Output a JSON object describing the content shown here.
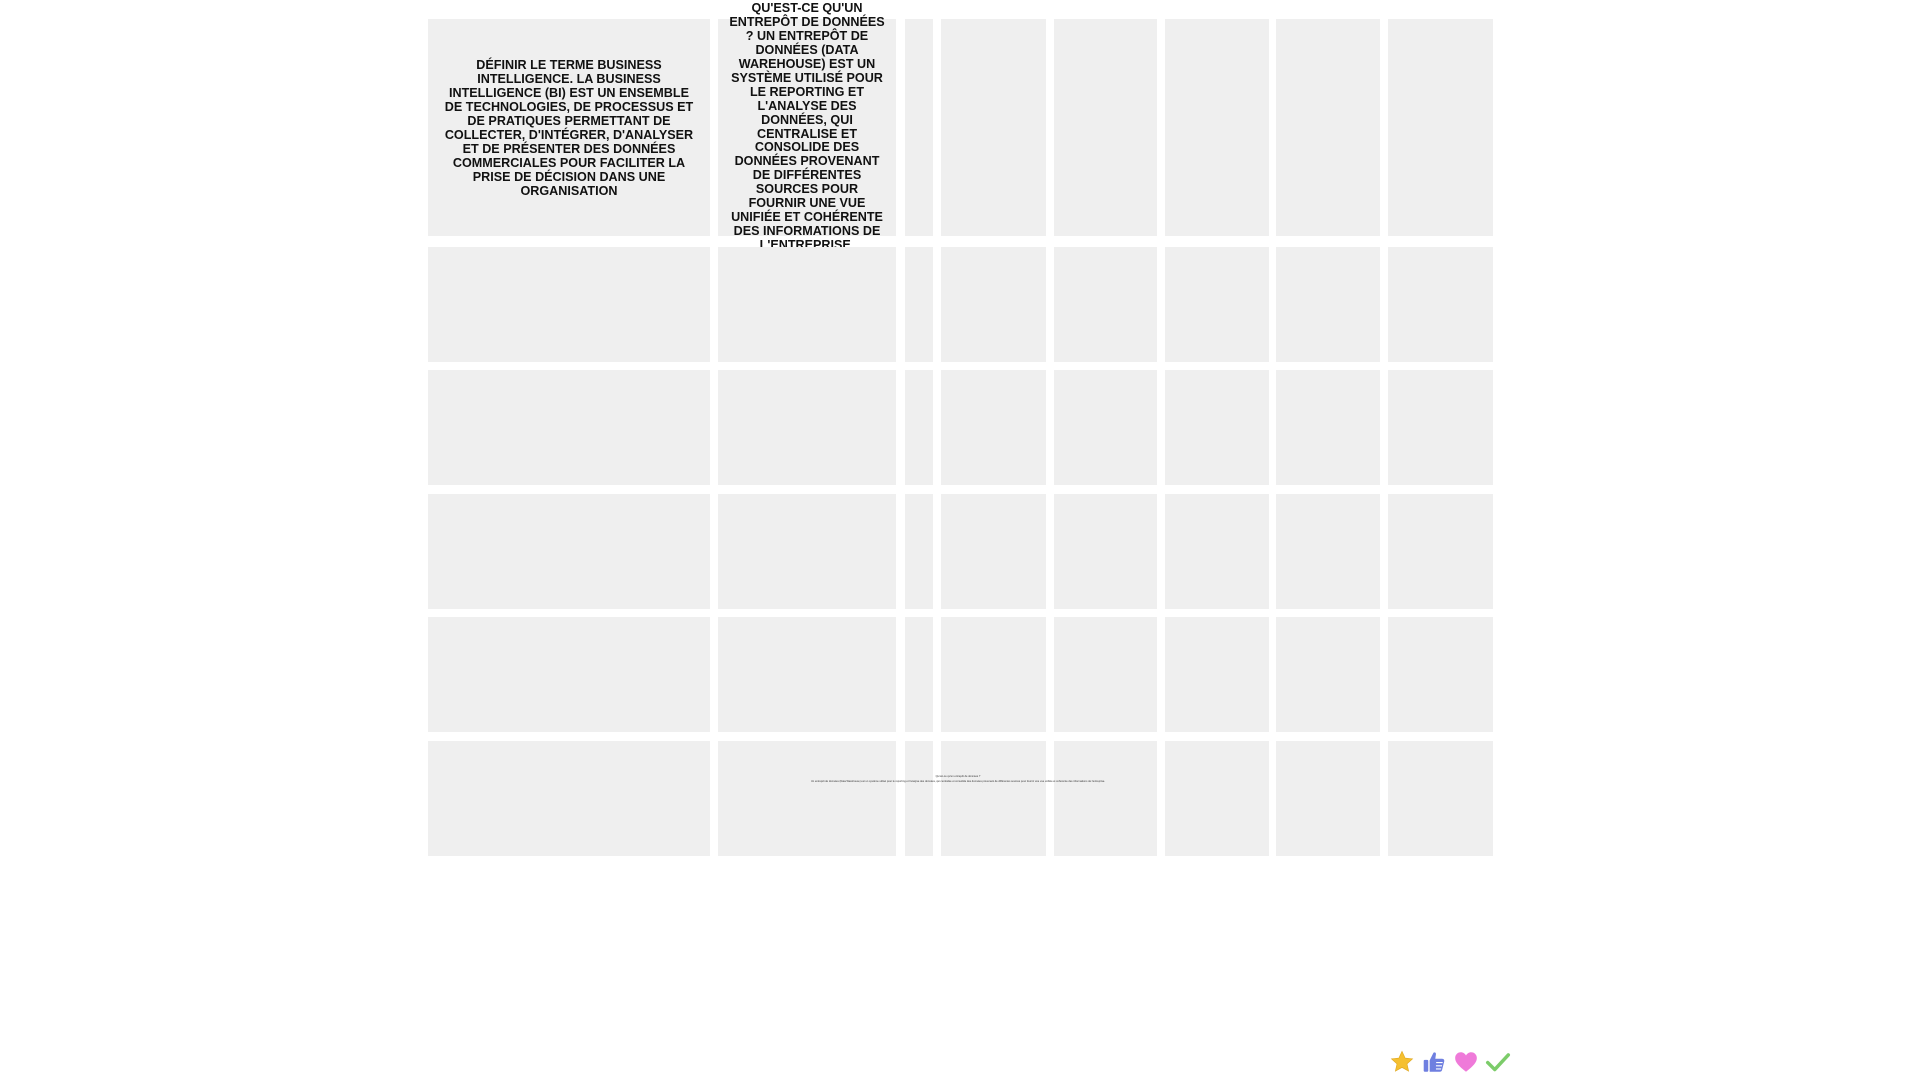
{
  "board": {
    "background_color": "#ffffff",
    "cell_color": "#efefef",
    "rows": 6,
    "columns": 8
  },
  "cells": {
    "r0c0": "Définir le terme Business intelligence. La Business Intelligence (BI) est un ensemble de technologies, de processus et de pratiques permettant de collecter, d'intégrer, d'analyser et de présenter des données commerciales pour faciliter la prise de décision dans une organisation",
    "r0c1": "Qu'est-ce qu'un entrepôt de données ? Un entrepôt de données (Data Warehouse) est un système utilisé pour le reporting et l'analyse des données, qui centralise et consolide des données provenant de différentes sources pour fournir une vue unifiée et cohérente des informations de l'entreprise."
  },
  "tiny_note": {
    "line1": "Qu'est-ce qu'un entrepôt de données ?",
    "line2": "Un entrepôt de données (Data Warehouse) est un système utilisé pour le reporting et l'analyse des données, qui centralise et consolide des données provenant de différentes sources pour fournir une vue unifiée et cohérente des informations de l'entreprise."
  },
  "reactions": [
    {
      "icon": "star-icon",
      "color": "#f5c030"
    },
    {
      "icon": "thumbs-up-icon",
      "color": "#6f7fe0"
    },
    {
      "icon": "heart-icon",
      "color": "#ef7ad9"
    },
    {
      "icon": "checkmark-icon",
      "color": "#7ccc6a"
    }
  ]
}
